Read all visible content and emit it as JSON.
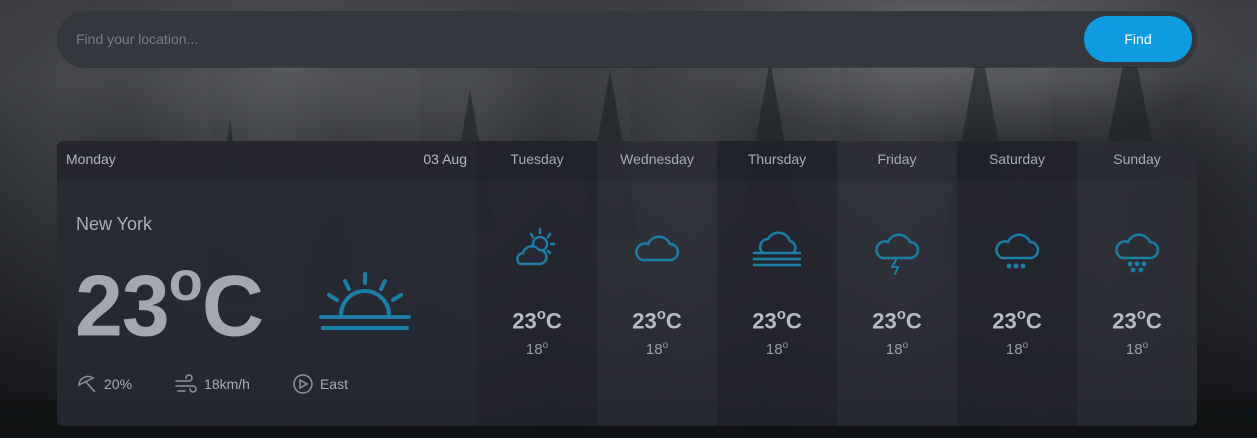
{
  "search": {
    "placeholder": "Find your location...",
    "button_label": "Find"
  },
  "today": {
    "day": "Monday",
    "date": "03 Aug",
    "location": "New York",
    "temp": "23",
    "temp_unit": "o",
    "temp_scale": "C",
    "icon": "sunrise-icon",
    "stats": {
      "precipitation": "20%",
      "wind": "18km/h",
      "direction": "East"
    }
  },
  "days": [
    {
      "name": "Tuesday",
      "high": "23",
      "deg": "o",
      "scale": "C",
      "low": "18",
      "low_deg": "o",
      "icon": "partly-cloudy-icon"
    },
    {
      "name": "Wednesday",
      "high": "23",
      "deg": "o",
      "scale": "C",
      "low": "18",
      "low_deg": "o",
      "icon": "cloud-icon"
    },
    {
      "name": "Thursday",
      "high": "23",
      "deg": "o",
      "scale": "C",
      "low": "18",
      "low_deg": "o",
      "icon": "fog-icon"
    },
    {
      "name": "Friday",
      "high": "23",
      "deg": "o",
      "scale": "C",
      "low": "18",
      "low_deg": "o",
      "icon": "thunderstorm-icon"
    },
    {
      "name": "Saturday",
      "high": "23",
      "deg": "o",
      "scale": "C",
      "low": "18",
      "low_deg": "o",
      "icon": "drizzle-icon"
    },
    {
      "name": "Sunday",
      "high": "23",
      "deg": "o",
      "scale": "C",
      "low": "18",
      "low_deg": "o",
      "icon": "snow-icon"
    }
  ],
  "colors": {
    "accent": "#0e9be0",
    "icon": "#1b7ea6"
  }
}
